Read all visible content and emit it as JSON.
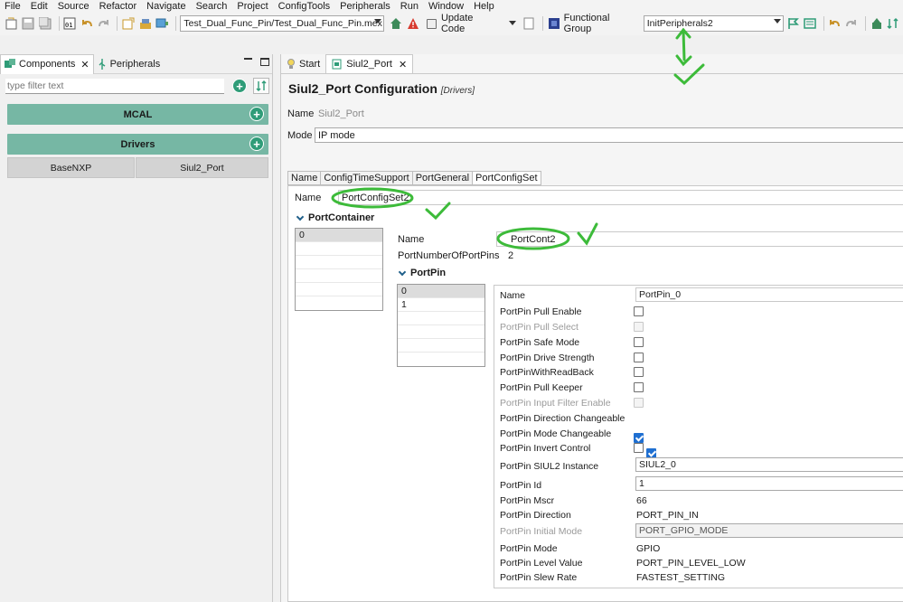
{
  "menu": [
    "File",
    "Edit",
    "Source",
    "Refactor",
    "Navigate",
    "Search",
    "Project",
    "ConfigTools",
    "Peripherals",
    "Run",
    "Window",
    "Help"
  ],
  "toolbar": {
    "project_path": "Test_Dual_Func_Pin/Test_Dual_Func_Pin.mex",
    "update_code_label": "Update Code",
    "functional_group_label": "Functional Group",
    "functional_group_value": "InitPeripherals2"
  },
  "left": {
    "tab_components": "Components",
    "tab_peripherals": "Peripherals",
    "filter_placeholder": "type filter text",
    "group_mcal": "MCAL",
    "group_drivers": "Drivers",
    "comp_basenxp": "BaseNXP",
    "comp_siul2": "Siul2_Port"
  },
  "editor": {
    "tab_start": "Start",
    "tab_siul2": "Siul2_Port",
    "title": "Siul2_Port Configuration",
    "title_sub": "[Drivers]",
    "name_label": "Name",
    "name_value": "Siul2_Port",
    "mode_label": "Mode",
    "mode_value": "IP mode",
    "sub_tabs": [
      "Name",
      "ConfigTimeSupport",
      "PortGeneral",
      "PortConfigSet"
    ],
    "cfgset_name_label": "Name",
    "cfgset_name_value": "PortConfigSet2",
    "port_container_label": "PortContainer",
    "container_items": [
      "0"
    ],
    "container_name_label": "Name",
    "container_name_value": "PortCont2",
    "num_pins_label": "PortNumberOfPortPins",
    "num_pins_value": "2",
    "port_pin_label": "PortPin",
    "pin_items": [
      "0",
      "1"
    ],
    "props": {
      "name_label": "Name",
      "name_value": "PortPin_0",
      "pull_enable": "PortPin Pull Enable",
      "pull_select": "PortPin Pull Select",
      "safe_mode": "PortPin Safe Mode",
      "drive_strength": "PortPin Drive Strength",
      "with_readback": "PortPinWithReadBack",
      "pull_keeper": "PortPin Pull Keeper",
      "input_filter": "PortPin Input Filter Enable",
      "direction_changeable": "PortPin Direction Changeable",
      "mode_changeable": "PortPin Mode Changeable",
      "invert_control": "PortPin Invert Control",
      "siul2_instance_label": "PortPin SIUL2 Instance",
      "siul2_instance_value": "SIUL2_0",
      "pin_id_label": "PortPin Id",
      "pin_id_value": "1",
      "mscr_label": "PortPin Mscr",
      "mscr_value": "66",
      "direction_label": "PortPin Direction",
      "direction_value": "PORT_PIN_IN",
      "initial_mode_label": "PortPin Initial Mode",
      "initial_mode_value": "PORT_GPIO_MODE",
      "mode_label": "PortPin Mode",
      "mode_value": "GPIO",
      "level_label": "PortPin Level Value",
      "level_value": "PORT_PIN_LEVEL_LOW",
      "slew_label": "PortPin Slew Rate",
      "slew_value": "FASTEST_SETTING"
    }
  },
  "colors": {
    "accent_green": "#2f9c78",
    "group_bar": "#76b7a4",
    "annotation_green": "#3dbb3a",
    "check_blue": "#1f6fd1"
  }
}
